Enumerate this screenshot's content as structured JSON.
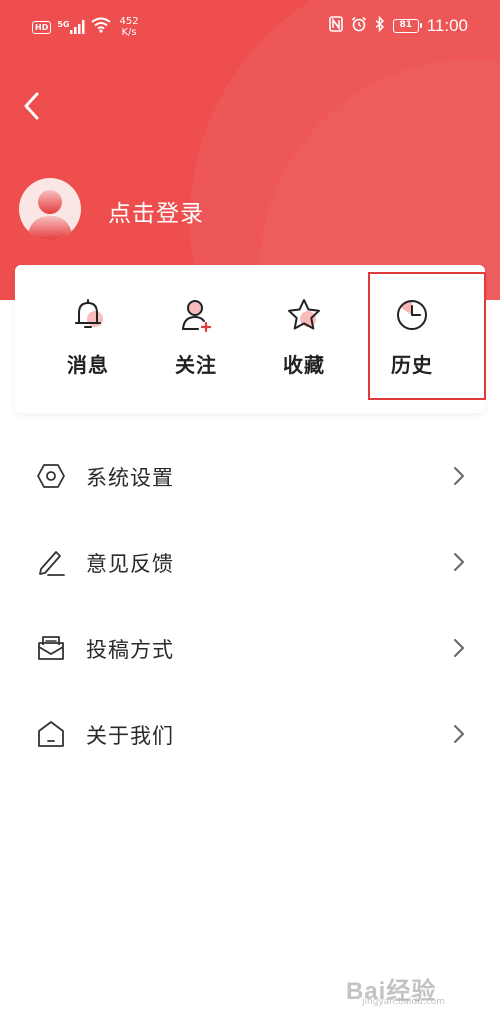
{
  "status_bar": {
    "hd": "HD",
    "network": "5G",
    "speed_value": "452",
    "speed_unit": "K/s",
    "battery": "81",
    "time": "11:00"
  },
  "profile": {
    "login_label": "点击登录"
  },
  "quick_actions": [
    {
      "label": "消息",
      "icon": "bell-icon"
    },
    {
      "label": "关注",
      "icon": "follow-user-icon"
    },
    {
      "label": "收藏",
      "icon": "star-icon"
    },
    {
      "label": "历史",
      "icon": "clock-icon"
    }
  ],
  "menu": [
    {
      "label": "系统设置",
      "icon": "settings-hexagon-icon"
    },
    {
      "label": "意见反馈",
      "icon": "pencil-icon"
    },
    {
      "label": "投稿方式",
      "icon": "envelope-icon"
    },
    {
      "label": "关于我们",
      "icon": "home-icon"
    }
  ],
  "colors": {
    "header": "#ee4e4e",
    "accent": "#e23a3a"
  },
  "watermark": {
    "main": "Bai经验",
    "sub": "jingyan.baidu.com"
  }
}
